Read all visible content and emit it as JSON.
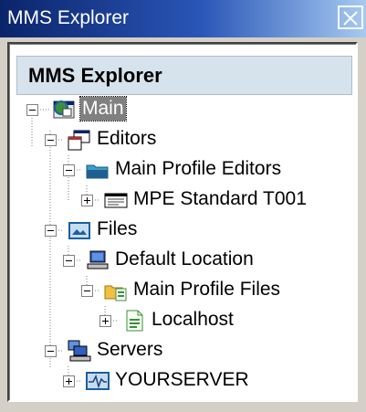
{
  "window": {
    "title": "MMS Explorer"
  },
  "panel": {
    "header": "MMS Explorer"
  },
  "tree": {
    "main": "Main",
    "editors": "Editors",
    "main_profile_editors": "Main Profile Editors",
    "mpe_standard": "MPE Standard T001",
    "files": "Files",
    "default_location": "Default Location",
    "main_profile_files": "Main Profile Files",
    "localhost": "Localhost",
    "servers": "Servers",
    "yourserver": "YOURSERVER"
  },
  "icons": {
    "main": "world-window-icon",
    "editors": "windows-stack-icon",
    "main_profile_editors": "folder-open-icon",
    "mpe_standard": "profile-card-icon",
    "files": "picture-folder-icon",
    "default_location": "computer-icon",
    "main_profile_files": "folder-file-icon",
    "localhost": "document-icon",
    "servers": "server-icon",
    "yourserver": "monitor-wave-icon"
  },
  "colors": {
    "titlebar": "#0a246a",
    "header_bg": "#d7e3ec",
    "selection": "#808080"
  }
}
